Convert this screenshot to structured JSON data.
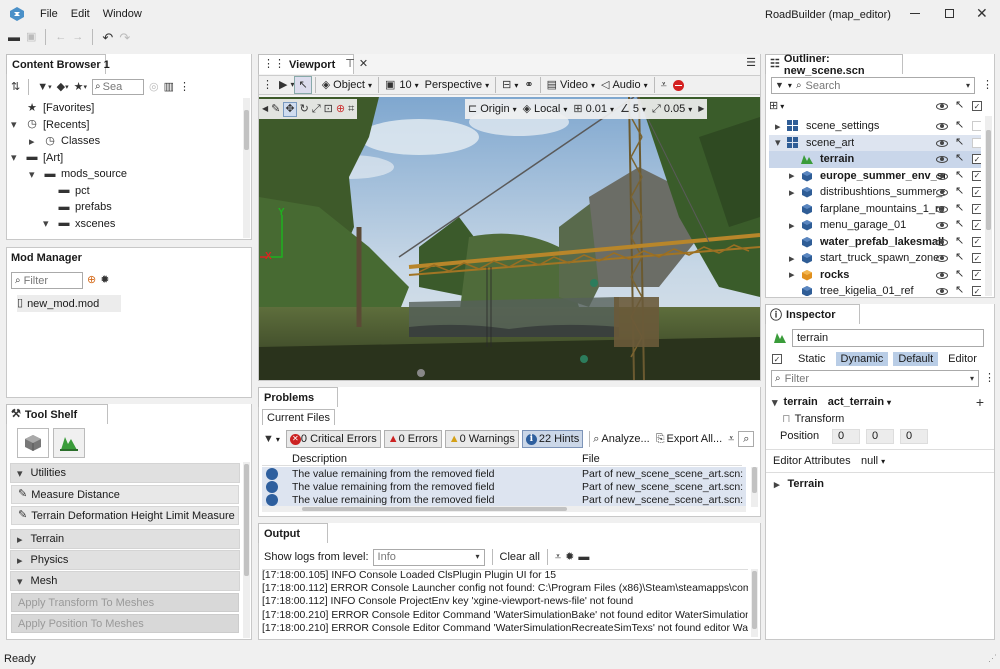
{
  "window": {
    "title": "RoadBuilder (map_editor)",
    "menu": [
      "File",
      "Edit",
      "Window"
    ],
    "status": "Ready"
  },
  "content_browser": {
    "title": "Content Browser 1",
    "search_placeholder": "Sea",
    "tree": [
      {
        "label": "[Favorites]",
        "icon": "star-icon"
      },
      {
        "label": "[Recents]",
        "icon": "clock-icon"
      },
      {
        "label": "Classes",
        "icon": "clock-icon"
      },
      {
        "label": "[Art]",
        "icon": "folder-icon"
      },
      {
        "label": "mods_source",
        "icon": "folder-icon"
      },
      {
        "label": "pct",
        "icon": "folder-icon"
      },
      {
        "label": "prefabs",
        "icon": "folder-icon"
      },
      {
        "label": "xscenes",
        "icon": "folder-icon"
      }
    ]
  },
  "mod_manager": {
    "title": "Mod Manager",
    "filter_placeholder": "Filter",
    "items": [
      "new_mod.mod"
    ]
  },
  "tool_shelf": {
    "title": "Tool Shelf",
    "sections": {
      "utilities": "Utilities",
      "terrain": "Terrain",
      "physics": "Physics",
      "mesh": "Mesh"
    },
    "utilities_items": [
      "Measure Distance",
      "Terrain Deformation Height Limit Measure"
    ],
    "mesh_items": [
      "Apply Transform To Meshes",
      "Apply Position To Meshes"
    ]
  },
  "viewport": {
    "title": "Viewport",
    "toolbar": {
      "mode": "Object",
      "camera_speed": "10",
      "projection": "Perspective",
      "video": "Video",
      "audio": "Audio"
    },
    "gizmo_bar": {
      "origin": "Origin",
      "space": "Local",
      "grid_snap": "0.01",
      "angle_snap": "5",
      "scale_snap": "0.05"
    },
    "axes": {
      "y": "Y",
      "x": "X"
    }
  },
  "problems": {
    "title": "Problems",
    "tab": "Current Files",
    "filters": {
      "critical": "0 Critical Errors",
      "errors": "0 Errors",
      "warnings": "0 Warnings",
      "hints": "22 Hints"
    },
    "analyze": "Analyze...",
    "export": "Export All...",
    "columns": [
      "Description",
      "File"
    ],
    "rows": [
      {
        "description": "The value remaining from the removed field",
        "file": "Part of new_scene_scene_art.scn: /C"
      },
      {
        "description": "The value remaining from the removed field",
        "file": "Part of new_scene_scene_art.scn: /C"
      },
      {
        "description": "The value remaining from the removed field",
        "file": "Part of new_scene_scene_art.scn: /C"
      }
    ]
  },
  "output": {
    "title": "Output",
    "level_label": "Show logs from level:",
    "level_value": "Info",
    "clear": "Clear all",
    "lines": [
      "[17:18:00.105]  INFO  Console    Loaded ClsPlugin Plugin UI for 15",
      "[17:18:00.112]  ERROR  Console  Launcher config not found: C:\\Program Files (x86)\\Steam\\steamapps\\common\\",
      "[17:18:00.112]  INFO  Console  ProjectEnv key 'xgine-viewport-news-file' not found",
      "[17:18:00.210]  ERROR  Console  Editor Command 'WaterSimulationBake' not found editor WaterSimulation",
      "[17:18:00.210]  ERROR  Console  Editor Command 'WaterSimulationRecreateSimTexs' not found editor WaterSim"
    ]
  },
  "outliner": {
    "title": "Outliner: new_scene.scn",
    "search_placeholder": "Search",
    "items": [
      {
        "label": "scene_settings",
        "bold": false,
        "icon": "cubes-icon",
        "arrow": "collapsed"
      },
      {
        "label": "scene_art",
        "bold": false,
        "icon": "cubes-icon",
        "arrow": "expanded"
      },
      {
        "label": "terrain",
        "bold": true,
        "icon": "terrain-icon",
        "arrow": "none"
      },
      {
        "label": "europe_summer_env_setu",
        "bold": true,
        "icon": "cube-icon",
        "arrow": "collapsed"
      },
      {
        "label": "distribushtions_summer_set",
        "bold": false,
        "icon": "cube-icon",
        "arrow": "collapsed"
      },
      {
        "label": "farplane_mountains_1_ref",
        "bold": false,
        "icon": "cube-icon",
        "arrow": "none"
      },
      {
        "label": "menu_garage_01",
        "bold": false,
        "icon": "cube-icon",
        "arrow": "collapsed"
      },
      {
        "label": "water_prefab_lakesmall",
        "bold": true,
        "icon": "cube-icon",
        "arrow": "none"
      },
      {
        "label": "start_truck_spawn_zone",
        "bold": false,
        "icon": "cube-icon",
        "arrow": "collapsed"
      },
      {
        "label": "rocks",
        "bold": true,
        "icon": "orange-cube-icon",
        "arrow": "collapsed"
      },
      {
        "label": "tree_kigelia_01_ref",
        "bold": false,
        "icon": "cube-icon",
        "arrow": "none"
      }
    ]
  },
  "inspector": {
    "title": "Inspector",
    "name": "terrain",
    "flags": [
      "Static",
      "Dynamic",
      "Default",
      "Editor"
    ],
    "filter_placeholder": "Filter",
    "object_label": "terrain",
    "class_label": "act_terrain",
    "transform_label": "Transform",
    "position_label": "Position",
    "position": [
      "0",
      "0",
      "0"
    ],
    "editor_attributes_label": "Editor Attributes",
    "editor_attributes_value": "null",
    "terrain_section": "Terrain"
  }
}
